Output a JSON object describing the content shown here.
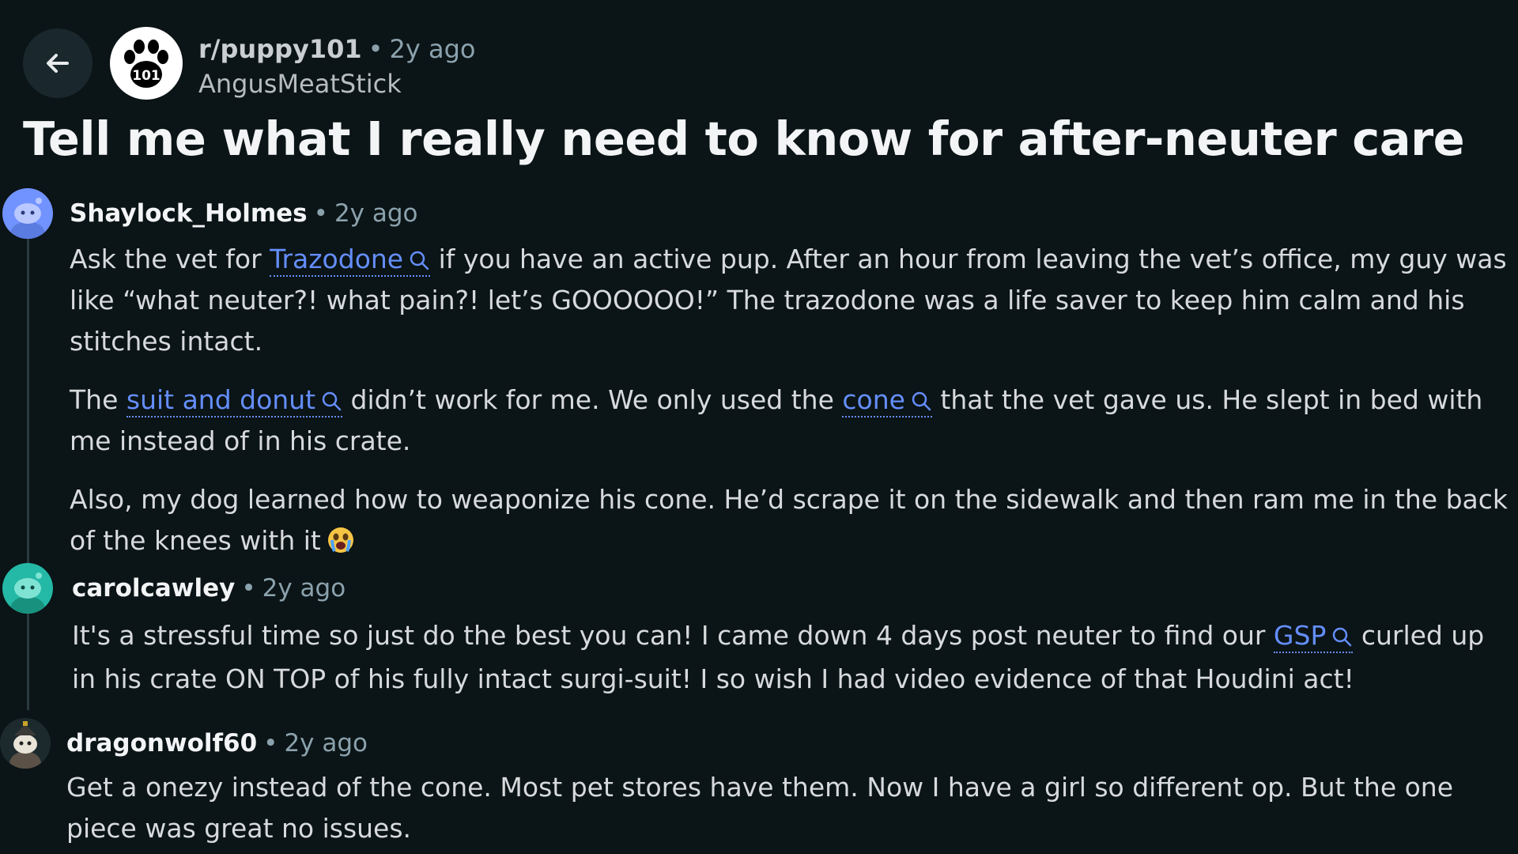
{
  "post": {
    "subreddit": "r/puppy101",
    "subreddit_badge": "101",
    "time": "2y ago",
    "author": "AngusMeatStick",
    "title": "Tell me what I really need to know for after-neuter care"
  },
  "comments": [
    {
      "user": "Shaylock_Holmes",
      "time": "2y ago",
      "p1_pre": "Ask the vet for ",
      "p1_link": "Trazodone",
      "p1_post": " if you have an active pup. After an hour from leaving the vet’s office, my guy was like “what neuter?! what pain?! let’s GOOOOOO!” The trazodone was a life saver to keep him calm and his stitches intact.",
      "p2_pre": "The ",
      "p2_link1": "suit and donut",
      "p2_mid": " didn’t work for me. We only used the ",
      "p2_link2": "cone",
      "p2_post": " that the vet gave us. He slept in bed with me instead of in his crate.",
      "p3": "Also, my dog learned how to weaponize his cone. He’d scrape it on the sidewalk and then ram me in the back of the knees with it"
    },
    {
      "user": "carolcawley",
      "time": "2y ago",
      "p1_pre": "It's a stressful time so just do the best you can! I came down 4 days post neuter to find our ",
      "p1_link": "GSP",
      "p1_post": " curled up in his crate ON TOP of his fully intact surgi-suit! I so wish I had video evidence of that Houdini act!"
    },
    {
      "user": "dragonwolf60",
      "time": "2y ago",
      "p1": "Get a onezy instead of the cone. Most pet stores have them. Now I have a girl so different op. But the one piece was great no issues."
    }
  ],
  "separator": "•",
  "colors": {
    "background": "#0b1416",
    "link": "#648efc",
    "meta": "#8ba2ad"
  },
  "icons": [
    "back-arrow-icon",
    "paw-icon",
    "search-icon",
    "crying-face-icon",
    "snoo-avatar-icon"
  ]
}
